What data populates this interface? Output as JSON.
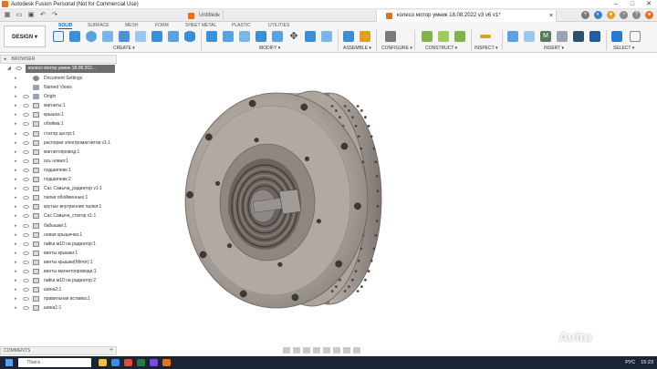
{
  "window": {
    "title": "Autodesk Fusion Personal (Not for Commercial Use)"
  },
  "doc_tabs": [
    {
      "label": "Untitled"
    },
    {
      "label": "колесо мотор умник 18.08.2022 v3 v6 v1*"
    }
  ],
  "toolbar": {
    "design_label": "DESIGN ▾",
    "workspace_tabs": [
      "SOLID",
      "SURFACE",
      "MESH",
      "FORM",
      "SHEET METAL",
      "PLASTIC",
      "UTILITIES"
    ],
    "groups": [
      "CREATE ▾",
      "MODIFY ▾",
      "ASSEMBLE ▾",
      "CONFIGURE ▾",
      "CONSTRUCT ▾",
      "INSPECT ▾",
      "INSERT ▾",
      "SELECT ▾"
    ]
  },
  "browser": {
    "header": "BROWSER",
    "root": "колесо мотор умник 18.08.202...",
    "items": [
      {
        "label": "Document Settings",
        "icon": "gear"
      },
      {
        "label": "Named Views",
        "icon": "folder"
      },
      {
        "label": "Origin",
        "icon": "folder"
      },
      {
        "label": "магниты:1",
        "icon": "comp"
      },
      {
        "label": "крышка:1",
        "icon": "comp"
      },
      {
        "label": "обойма:1",
        "icon": "comp"
      },
      {
        "label": "статор центр:1",
        "icon": "comp"
      },
      {
        "label": "распорки электромагнитов v1:1",
        "icon": "comp"
      },
      {
        "label": "магнитопровод:1",
        "icon": "comp"
      },
      {
        "label": "ось новая:1",
        "icon": "comp"
      },
      {
        "label": "подшипник:1",
        "icon": "comp"
      },
      {
        "label": "подшипник:2",
        "icon": "comp"
      },
      {
        "label": "Сас Савыча_радиатор v1:1",
        "icon": "comp"
      },
      {
        "label": "палки обойменные:1",
        "icon": "comp"
      },
      {
        "label": "крутые внутренние палки:1",
        "icon": "comp"
      },
      {
        "label": "Сас Савыча_статор v1:1",
        "icon": "comp"
      },
      {
        "label": "бабышки:1",
        "icon": "comp"
      },
      {
        "label": "новая крышечка:1",
        "icon": "comp"
      },
      {
        "label": "гайка м10 на радиатор:1",
        "icon": "comp"
      },
      {
        "label": "винты крышки:1",
        "icon": "comp"
      },
      {
        "label": "винты крышки(Mirror):1",
        "icon": "comp"
      },
      {
        "label": "винты магнитопровода:1",
        "icon": "comp"
      },
      {
        "label": "гайка м10 на радиатор:2",
        "icon": "comp"
      },
      {
        "label": "шина2:1",
        "icon": "comp"
      },
      {
        "label": "правильная вставка:1",
        "icon": "comp"
      },
      {
        "label": "шина1:1",
        "icon": "comp"
      }
    ]
  },
  "comments": {
    "label": "COMMENTS"
  },
  "taskbar": {
    "search_placeholder": "Поиск",
    "lang": "РУС",
    "time": "15:23"
  },
  "watermark": "Avito",
  "colors": {
    "accent": "#0a64b4",
    "selection": "#6e6e6e",
    "taskbar": "#1b2435"
  }
}
